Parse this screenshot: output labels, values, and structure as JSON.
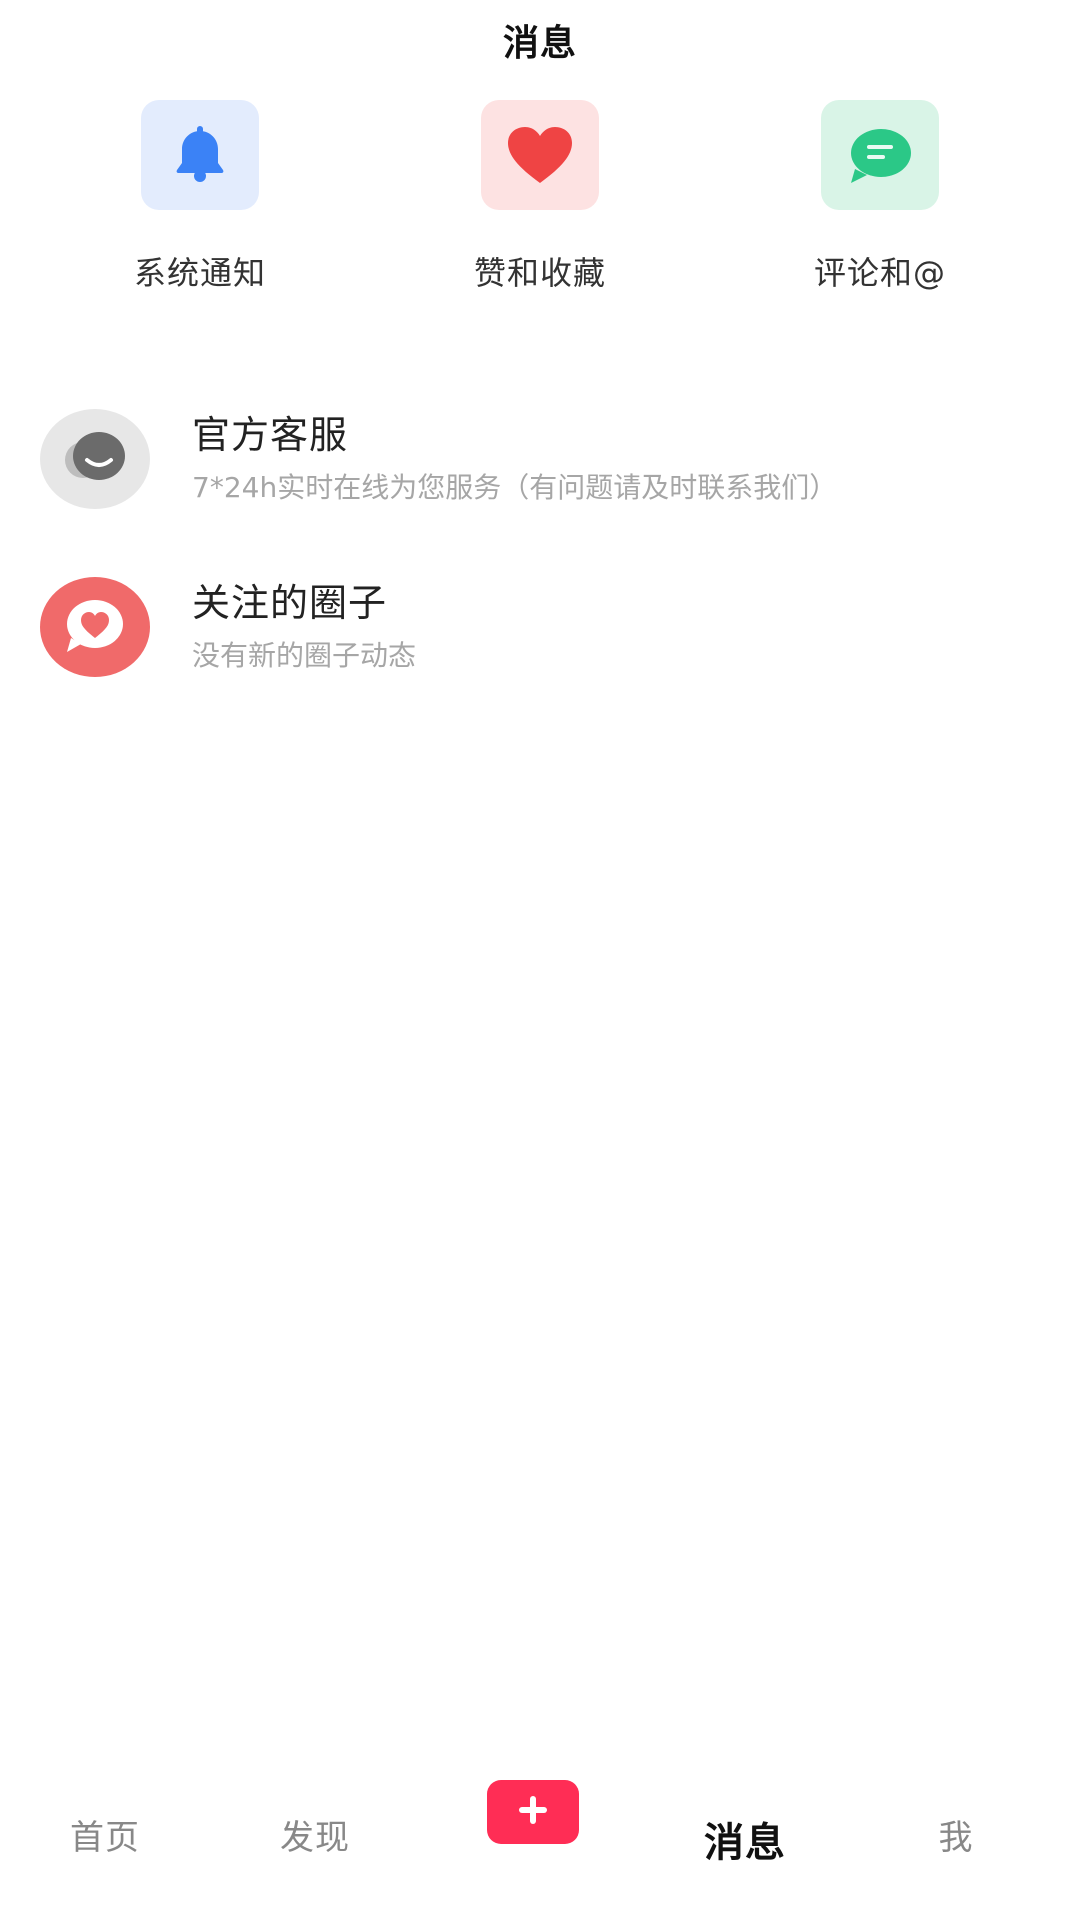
{
  "header": {
    "title": "消息"
  },
  "quick_actions": [
    {
      "label": "系统通知",
      "icon": "bell-icon",
      "bg": "#e3ecfd",
      "color": "#3b82f6"
    },
    {
      "label": "赞和收藏",
      "icon": "heart-icon",
      "bg": "#fde2e2",
      "color": "#ef4444"
    },
    {
      "label": "评论和@",
      "icon": "comment-icon",
      "bg": "#d9f4e7",
      "color": "#2bc887"
    }
  ],
  "messages": [
    {
      "title": "官方客服",
      "subtitle": "7*24h实时在线为您服务（有问题请及时联系我们）",
      "icon": "customer-service-icon"
    },
    {
      "title": "关注的圈子",
      "subtitle": "没有新的圈子动态",
      "icon": "circle-heart-icon"
    }
  ],
  "tabbar": {
    "tabs": [
      "首页",
      "发现",
      "消息",
      "我"
    ],
    "active": "消息",
    "plus_icon": "plus-icon",
    "accent": "#ff2d55"
  }
}
